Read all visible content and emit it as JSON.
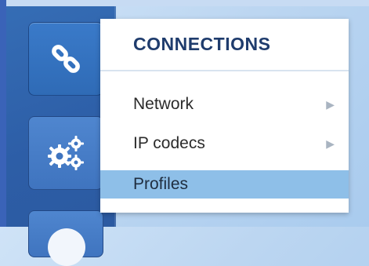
{
  "menu": {
    "title": "CONNECTIONS",
    "items": [
      {
        "label": "Network",
        "has_submenu": true,
        "selected": false
      },
      {
        "label": "IP codecs",
        "has_submenu": true,
        "selected": false
      },
      {
        "label": "Profiles",
        "has_submenu": false,
        "selected": true
      }
    ]
  },
  "sidebar": {
    "items": [
      {
        "icon": "link-icon",
        "active": true
      },
      {
        "icon": "gears-icon",
        "active": false
      },
      {
        "icon": "circle-icon",
        "active": false
      }
    ]
  },
  "colors": {
    "background": "#bcd6f1",
    "sidebar": "#2f62aa",
    "menu_header_text": "#1f3c6d",
    "selected_item": "#8ebfe8"
  },
  "icons": {
    "submenu_indicator": "chevron-right-icon"
  }
}
